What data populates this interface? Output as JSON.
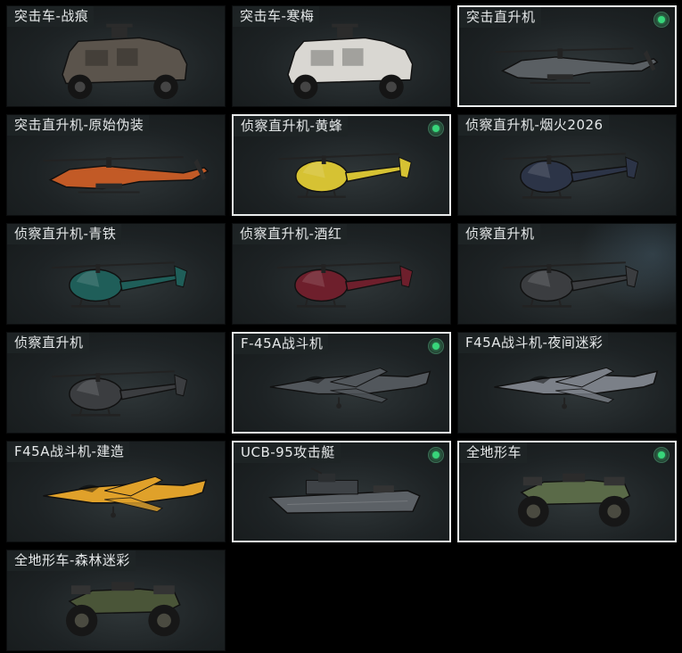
{
  "vehicles": [
    {
      "label": "突击车-战痕",
      "selected": false,
      "icon": "armored-truck-icon",
      "color": "#5b544c"
    },
    {
      "label": "突击车-寒梅",
      "selected": false,
      "icon": "armored-truck-icon",
      "color": "#d9d7d2"
    },
    {
      "label": "突击直升机",
      "selected": true,
      "icon": "attack-helicopter-icon",
      "color": "#5a5f63"
    },
    {
      "label": "突击直升机-原始伪装",
      "selected": false,
      "icon": "attack-helicopter-icon",
      "color": "#c25a26"
    },
    {
      "label": "侦察直升机-黄蜂",
      "selected": true,
      "icon": "scout-helicopter-icon",
      "color": "#d6c233"
    },
    {
      "label": "侦察直升机-烟火2026",
      "selected": false,
      "icon": "scout-helicopter-icon",
      "color": "#2c3447"
    },
    {
      "label": "侦察直升机-青铁",
      "selected": false,
      "icon": "scout-helicopter-icon",
      "color": "#1f5e59"
    },
    {
      "label": "侦察直升机-酒红",
      "selected": false,
      "icon": "scout-helicopter-icon",
      "color": "#6e1f2c"
    },
    {
      "label": "侦察直升机",
      "selected": false,
      "icon": "scout-helicopter-icon",
      "color": "#3b3d40"
    },
    {
      "label": "侦察直升机",
      "selected": false,
      "icon": "scout-helicopter-icon",
      "color": "#3b3d40"
    },
    {
      "label": "F-45A战斗机",
      "selected": true,
      "icon": "fighter-jet-icon",
      "color": "#52575c"
    },
    {
      "label": "F45A战斗机-夜间迷彩",
      "selected": false,
      "icon": "fighter-jet-icon",
      "color": "#7b8088"
    },
    {
      "label": "F45A战斗机-建造",
      "selected": false,
      "icon": "fighter-jet-icon",
      "color": "#e0a12a"
    },
    {
      "label": "UCB-95攻击艇",
      "selected": true,
      "icon": "attack-boat-icon",
      "color": "#5c6166"
    },
    {
      "label": "全地形车",
      "selected": true,
      "icon": "atv-icon",
      "color": "#5a6a48"
    },
    {
      "label": "全地形车-森林迷彩",
      "selected": false,
      "icon": "atv-icon",
      "color": "#4a5538"
    }
  ],
  "colors": {
    "selected_border": "#e9ecec",
    "badge": "#38d57a"
  }
}
